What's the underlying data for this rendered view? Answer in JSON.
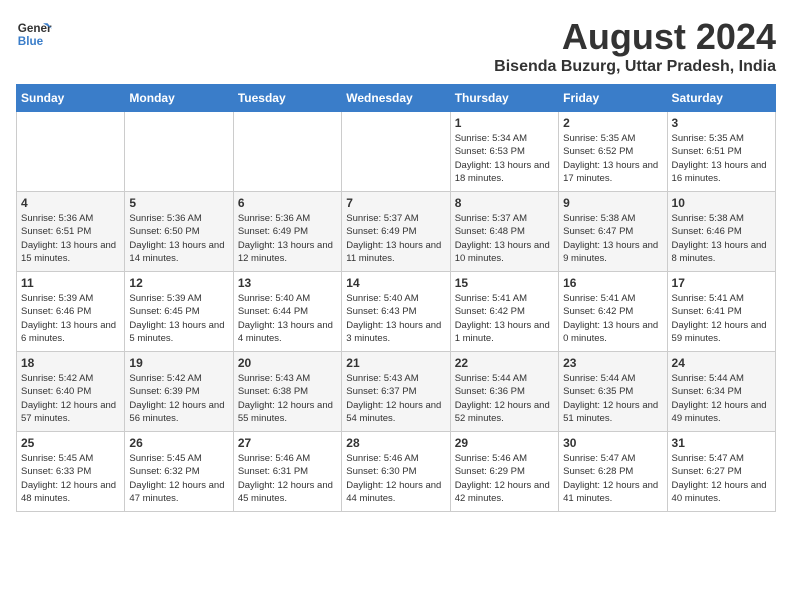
{
  "header": {
    "logo_line1": "General",
    "logo_line2": "Blue",
    "main_title": "August 2024",
    "subtitle": "Bisenda Buzurg, Uttar Pradesh, India"
  },
  "days_of_week": [
    "Sunday",
    "Monday",
    "Tuesday",
    "Wednesday",
    "Thursday",
    "Friday",
    "Saturday"
  ],
  "weeks": [
    [
      {
        "day": "",
        "info": ""
      },
      {
        "day": "",
        "info": ""
      },
      {
        "day": "",
        "info": ""
      },
      {
        "day": "",
        "info": ""
      },
      {
        "day": "1",
        "info": "Sunrise: 5:34 AM\nSunset: 6:53 PM\nDaylight: 13 hours and 18 minutes."
      },
      {
        "day": "2",
        "info": "Sunrise: 5:35 AM\nSunset: 6:52 PM\nDaylight: 13 hours and 17 minutes."
      },
      {
        "day": "3",
        "info": "Sunrise: 5:35 AM\nSunset: 6:51 PM\nDaylight: 13 hours and 16 minutes."
      }
    ],
    [
      {
        "day": "4",
        "info": "Sunrise: 5:36 AM\nSunset: 6:51 PM\nDaylight: 13 hours and 15 minutes."
      },
      {
        "day": "5",
        "info": "Sunrise: 5:36 AM\nSunset: 6:50 PM\nDaylight: 13 hours and 14 minutes."
      },
      {
        "day": "6",
        "info": "Sunrise: 5:36 AM\nSunset: 6:49 PM\nDaylight: 13 hours and 12 minutes."
      },
      {
        "day": "7",
        "info": "Sunrise: 5:37 AM\nSunset: 6:49 PM\nDaylight: 13 hours and 11 minutes."
      },
      {
        "day": "8",
        "info": "Sunrise: 5:37 AM\nSunset: 6:48 PM\nDaylight: 13 hours and 10 minutes."
      },
      {
        "day": "9",
        "info": "Sunrise: 5:38 AM\nSunset: 6:47 PM\nDaylight: 13 hours and 9 minutes."
      },
      {
        "day": "10",
        "info": "Sunrise: 5:38 AM\nSunset: 6:46 PM\nDaylight: 13 hours and 8 minutes."
      }
    ],
    [
      {
        "day": "11",
        "info": "Sunrise: 5:39 AM\nSunset: 6:46 PM\nDaylight: 13 hours and 6 minutes."
      },
      {
        "day": "12",
        "info": "Sunrise: 5:39 AM\nSunset: 6:45 PM\nDaylight: 13 hours and 5 minutes."
      },
      {
        "day": "13",
        "info": "Sunrise: 5:40 AM\nSunset: 6:44 PM\nDaylight: 13 hours and 4 minutes."
      },
      {
        "day": "14",
        "info": "Sunrise: 5:40 AM\nSunset: 6:43 PM\nDaylight: 13 hours and 3 minutes."
      },
      {
        "day": "15",
        "info": "Sunrise: 5:41 AM\nSunset: 6:42 PM\nDaylight: 13 hours and 1 minute."
      },
      {
        "day": "16",
        "info": "Sunrise: 5:41 AM\nSunset: 6:42 PM\nDaylight: 13 hours and 0 minutes."
      },
      {
        "day": "17",
        "info": "Sunrise: 5:41 AM\nSunset: 6:41 PM\nDaylight: 12 hours and 59 minutes."
      }
    ],
    [
      {
        "day": "18",
        "info": "Sunrise: 5:42 AM\nSunset: 6:40 PM\nDaylight: 12 hours and 57 minutes."
      },
      {
        "day": "19",
        "info": "Sunrise: 5:42 AM\nSunset: 6:39 PM\nDaylight: 12 hours and 56 minutes."
      },
      {
        "day": "20",
        "info": "Sunrise: 5:43 AM\nSunset: 6:38 PM\nDaylight: 12 hours and 55 minutes."
      },
      {
        "day": "21",
        "info": "Sunrise: 5:43 AM\nSunset: 6:37 PM\nDaylight: 12 hours and 54 minutes."
      },
      {
        "day": "22",
        "info": "Sunrise: 5:44 AM\nSunset: 6:36 PM\nDaylight: 12 hours and 52 minutes."
      },
      {
        "day": "23",
        "info": "Sunrise: 5:44 AM\nSunset: 6:35 PM\nDaylight: 12 hours and 51 minutes."
      },
      {
        "day": "24",
        "info": "Sunrise: 5:44 AM\nSunset: 6:34 PM\nDaylight: 12 hours and 49 minutes."
      }
    ],
    [
      {
        "day": "25",
        "info": "Sunrise: 5:45 AM\nSunset: 6:33 PM\nDaylight: 12 hours and 48 minutes."
      },
      {
        "day": "26",
        "info": "Sunrise: 5:45 AM\nSunset: 6:32 PM\nDaylight: 12 hours and 47 minutes."
      },
      {
        "day": "27",
        "info": "Sunrise: 5:46 AM\nSunset: 6:31 PM\nDaylight: 12 hours and 45 minutes."
      },
      {
        "day": "28",
        "info": "Sunrise: 5:46 AM\nSunset: 6:30 PM\nDaylight: 12 hours and 44 minutes."
      },
      {
        "day": "29",
        "info": "Sunrise: 5:46 AM\nSunset: 6:29 PM\nDaylight: 12 hours and 42 minutes."
      },
      {
        "day": "30",
        "info": "Sunrise: 5:47 AM\nSunset: 6:28 PM\nDaylight: 12 hours and 41 minutes."
      },
      {
        "day": "31",
        "info": "Sunrise: 5:47 AM\nSunset: 6:27 PM\nDaylight: 12 hours and 40 minutes."
      }
    ]
  ]
}
